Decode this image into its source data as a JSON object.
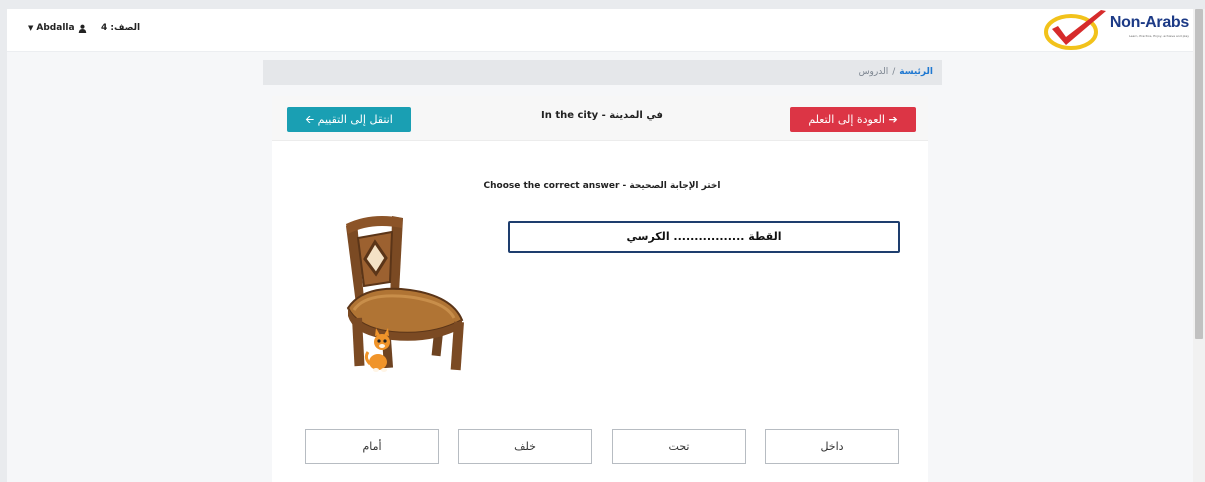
{
  "navbar": {
    "user_name": "Abdalla",
    "grade_label": "الصف: 4",
    "logo_text": "Non-Arabs",
    "logo_tagline": "Learn, Practice, Enjoy, achieve and play"
  },
  "breadcrumb": {
    "home": "الرئيسة",
    "separator": "/",
    "current": "الدروس"
  },
  "header": {
    "back_label": "العودة إلى التعلم",
    "back_arrow": "➔",
    "title": "في المدينة - In the city",
    "next_label": "انتقل إلى التقييم",
    "next_arrow": "🡨"
  },
  "exercise": {
    "instruction": "اختر الإجابة الصحيحة - Choose the correct answer",
    "sentence": "القطة ................. الكرسي",
    "image_icon": "chair-with-cat-under-it"
  },
  "options": [
    "داخل",
    "تحت",
    "خلف",
    "أمام"
  ],
  "colors": {
    "back_button": "#dc3545",
    "next_button": "#1a9fb3",
    "breadcrumb_link": "#1f78d1",
    "question_border": "#1e3e6e",
    "logo": "#1c3a86"
  }
}
